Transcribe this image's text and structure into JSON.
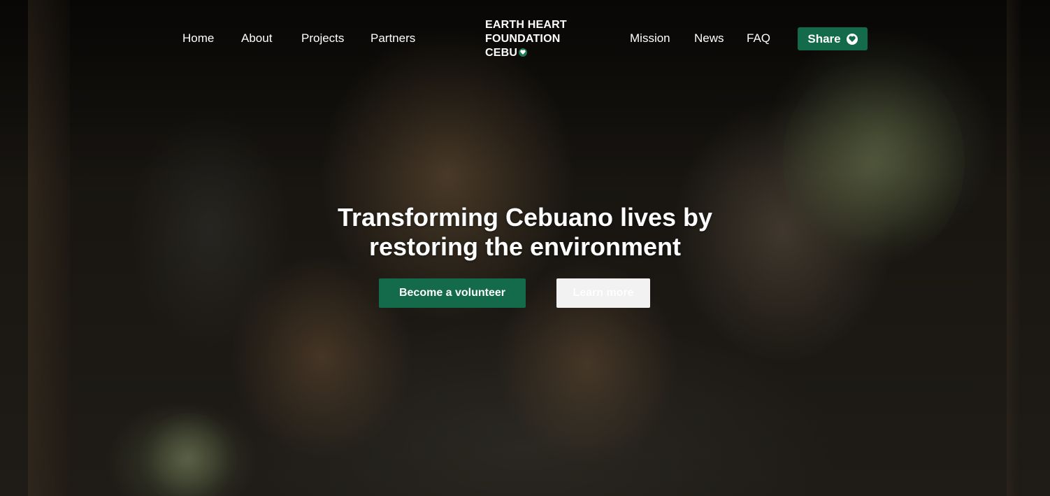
{
  "nav": {
    "left_links": [
      "Home",
      "About",
      "Projects",
      "Partners"
    ],
    "right_links": [
      "Mission",
      "News",
      "FAQ"
    ],
    "share_label": "Share"
  },
  "logo": {
    "line1": "EARTH HEART",
    "line2": "FOUNDATION",
    "line3": "CEBU"
  },
  "hero": {
    "headline_line1": "Transforming Cebuano lives by",
    "headline_line2": "restoring the environment",
    "primary_cta": "Become a volunteer",
    "secondary_cta": "Learn more"
  },
  "colors": {
    "brand_green": "#146b4c",
    "secondary_button": "#f2f2f2",
    "text": "#ffffff"
  },
  "icons": {
    "logo_icon": "heart-icon",
    "share_icon": "heart-icon"
  }
}
